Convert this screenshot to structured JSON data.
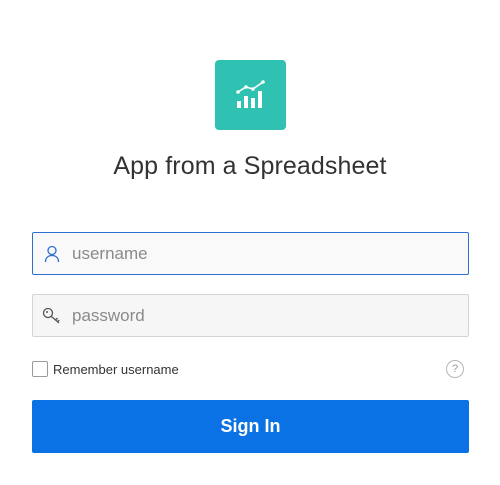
{
  "app": {
    "title": "App from a Spreadsheet",
    "logo_icon": "chart-trend-icon",
    "logo_color": "#2fc2b2"
  },
  "form": {
    "username": {
      "placeholder": "username",
      "value": "",
      "icon": "user-icon",
      "focused": true
    },
    "password": {
      "placeholder": "password",
      "value": "",
      "icon": "key-icon"
    },
    "remember": {
      "label": "Remember username",
      "checked": false
    },
    "help": {
      "glyph": "?",
      "icon": "help-icon"
    },
    "signin": {
      "label": "Sign In",
      "color": "#0a72e4"
    }
  }
}
